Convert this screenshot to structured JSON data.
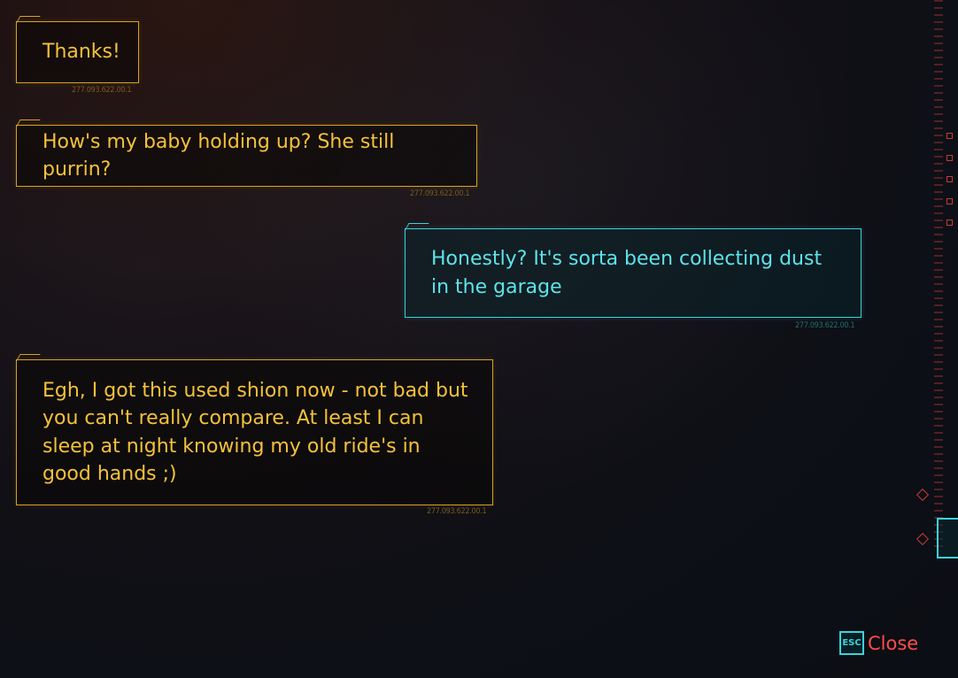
{
  "messages": [
    {
      "sender": "npc",
      "text": "Thanks!",
      "timestamp": "277.093.622.00.1"
    },
    {
      "sender": "npc",
      "text": "How's my baby holding up? She still purrin?",
      "timestamp": "277.093.622.00.1"
    },
    {
      "sender": "player",
      "text": "Honestly? It's sorta been collecting dust in the garage",
      "timestamp": "277.093.622.00.1"
    },
    {
      "sender": "npc",
      "text": "Egh, I got this used shion now - not bad but you can't really compare. At least I can sleep at night knowing my old ride's in good hands ;)",
      "timestamp": "277.093.622.00.1"
    }
  ],
  "close_button": {
    "key": "ESC",
    "label": "Close"
  },
  "colors": {
    "npc": "#f4c13a",
    "player": "#5ee3ea",
    "close": "#ff4b4b"
  }
}
